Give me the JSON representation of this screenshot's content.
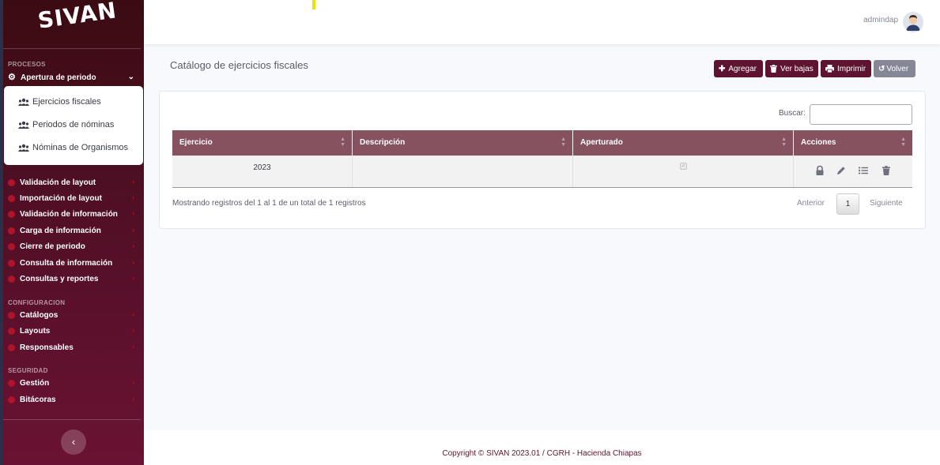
{
  "app": {
    "brand": "SIVAN",
    "user": "admindap"
  },
  "sidebar": {
    "procesos_heading": "PROCESOS",
    "active_item": "Apertura de periodo",
    "submenu": [
      "Ejercicios fiscales",
      "Periodos de nóminas",
      "Nóminas de Organismos"
    ],
    "procesos": [
      "Validación de layout",
      "Importación de layout",
      "Validación de información",
      "Carga de información",
      "Cierre de periodo",
      "Consulta de información",
      "Consultas y reportes"
    ],
    "config_heading": "CONFIGURACION",
    "configuracion": [
      "Catálogos",
      "Layouts",
      "Responsables"
    ],
    "seguridad_heading": "SEGURIDAD",
    "seguridad": [
      "Gestión",
      "Bitácoras"
    ]
  },
  "page": {
    "title": "Catálogo de ejercicios fiscales",
    "buttons": {
      "add": "Agregar",
      "view_deleted": "Ver bajas",
      "print": "Imprimir",
      "back": "Volver"
    }
  },
  "table": {
    "search_label": "Buscar:",
    "search_value": "",
    "columns": [
      "Ejercicio",
      "Descripción",
      "Aperturado",
      "Acciones"
    ],
    "rows": [
      {
        "ejercicio": "2023",
        "descripcion": "",
        "aperturado": true
      }
    ],
    "info": "Mostrando registros del 1 al 1 de un total de 1 registros",
    "pagination": {
      "prev": "Anterior",
      "current": "1",
      "next": "Siguiente"
    }
  },
  "footer": {
    "text": "Copyright © SIVAN 2023.01 / CGRH - Hacienda Chiapas"
  },
  "colors": {
    "primary": "#5e1431",
    "header": "#87525f",
    "gray_button": "#858796",
    "bullet": "#b0142a"
  }
}
